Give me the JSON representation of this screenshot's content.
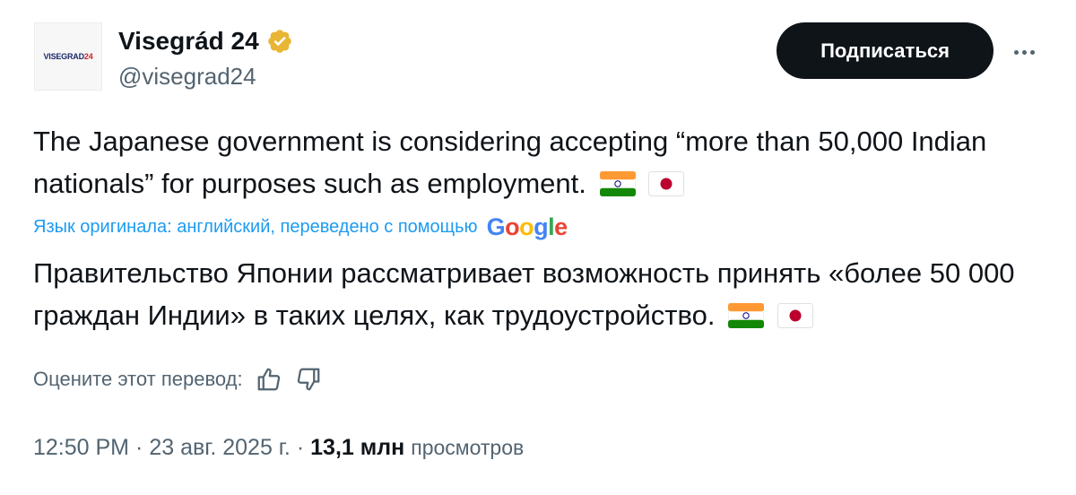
{
  "author": {
    "avatar_text": "VISEGRAD",
    "avatar_text_num": "24",
    "display_name": "Visegrád 24",
    "handle": "@visegrad24",
    "verified": true
  },
  "actions": {
    "subscribe_label": "Подписаться",
    "more_icon": "more-horizontal-icon"
  },
  "tweet": {
    "original_text": "The Japanese government is considering accepting “more than 50,000 Indian nationals” for purposes such as employment.",
    "translation_note": "Язык оригинала: английский, переведено с помощью",
    "translation_provider": "Google",
    "translated_text": "Правительство Японии рассматривает возможность принять «более 50 000 граждан Индии» в таких целях, как трудоустройство.",
    "flags": [
      "india-flag-icon",
      "japan-flag-icon"
    ]
  },
  "rating": {
    "label": "Оцените этот перевод:",
    "up_icon": "thumbs-up-icon",
    "down_icon": "thumbs-down-icon"
  },
  "meta": {
    "time": "12:50 PM",
    "separator": "·",
    "date": "23 авг. 2025 г.",
    "views_count": "13,1 млн",
    "views_label": "просмотров"
  },
  "colors": {
    "link_blue": "#1d9bf0",
    "text_primary": "#0f1419",
    "text_secondary": "#536471",
    "verified_gold": "#e8b634"
  }
}
